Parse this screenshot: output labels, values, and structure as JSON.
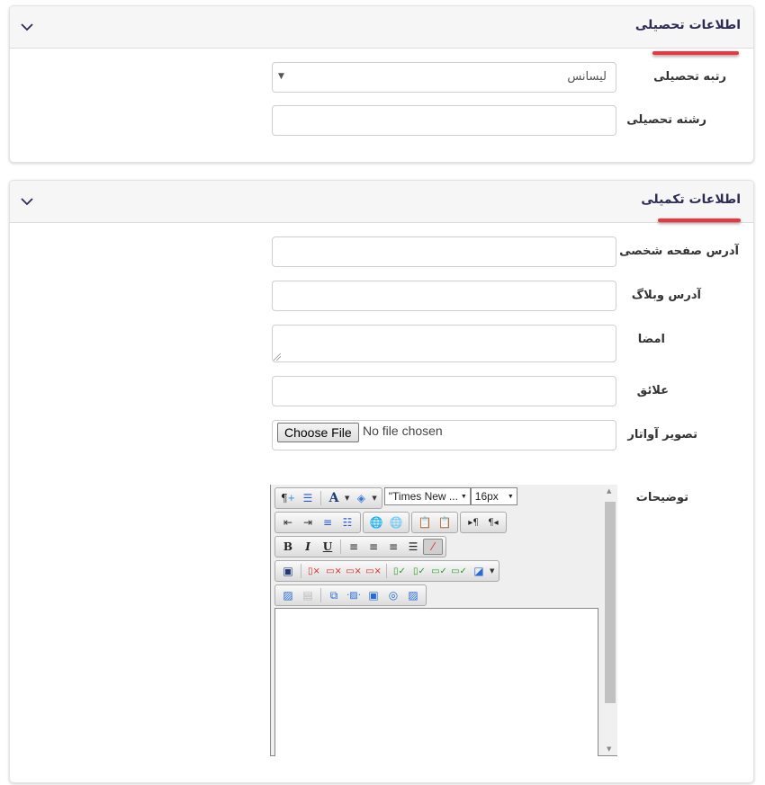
{
  "education_panel": {
    "title": "اطلاعات تحصیلی",
    "fields": {
      "degree_label": "رتبه تحصیلی",
      "degree_value": "لیسانس",
      "major_label": "رشته تحصیلی",
      "major_value": ""
    }
  },
  "additional_panel": {
    "title": "اطلاعات تکمیلی",
    "fields": {
      "homepage_label": "آدرس صفحه شخصی",
      "weblog_label": "آدرس وبلاگ",
      "signature_label": "امضا",
      "interests_label": "علائق",
      "avatar_label": "تصویر آواتار",
      "choose_file_label": "Choose File",
      "no_file_text": "No file chosen",
      "description_label": "توضیحات"
    },
    "editor": {
      "font_family": "\"Times New ...",
      "font_size": "16px",
      "toolbar_icons": [
        [
          "paragraph-insert-icon",
          "horizontal-rule-icon",
          "font-color-icon",
          "background-color-icon"
        ],
        [
          "outdent-icon",
          "indent-icon",
          "ordered-list-icon",
          "unordered-list-icon",
          "insert-link-icon",
          "remove-link-icon",
          "paste-word-icon",
          "paste-text-icon",
          "ltr-icon",
          "rtl-icon"
        ],
        [
          "bold-icon",
          "italic-icon",
          "underline-icon",
          "align-left-icon",
          "align-center-icon",
          "align-right-icon",
          "justify-icon",
          "remove-format-icon"
        ],
        [
          "insert-table-icon",
          "delete-column-icon",
          "delete-row-icon",
          "delete-cell-icon",
          "delete-table-icon",
          "insert-column-icon",
          "insert-row-icon",
          "insert-cell-icon",
          "table-properties-icon",
          "cell-properties-icon"
        ],
        [
          "insert-image-icon",
          "insert-document-icon",
          "image-gallery-icon",
          "insert-media-icon",
          "image-frame-icon",
          "web-image-icon",
          "image-edit-icon"
        ]
      ]
    }
  },
  "colors": {
    "accent_underline": "#f2323c",
    "title_text": "#2c2c54"
  }
}
